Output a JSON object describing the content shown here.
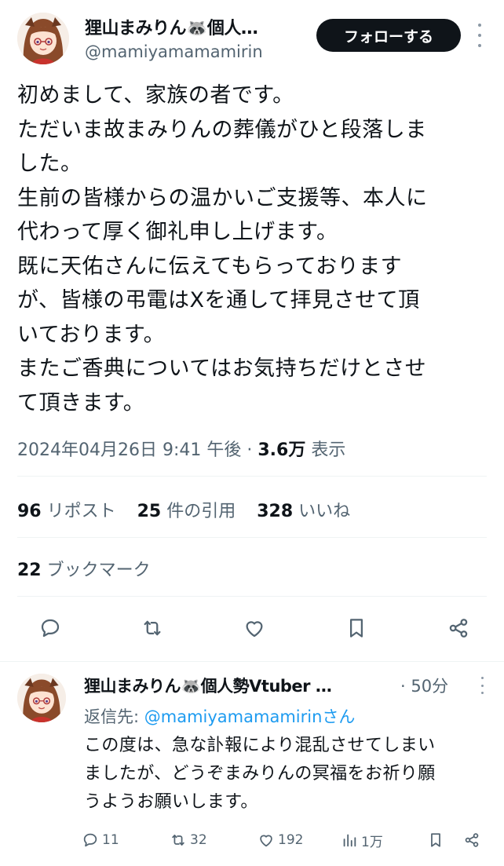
{
  "tweet": {
    "author": {
      "display_name": "狸山まみりん🦝個人…",
      "handle": "@mamiyamamamirin"
    },
    "follow_label": "フォローする",
    "lines": [
      "初めまして、家族の者です。",
      "ただいま故まみりんの葬儀がひと段落しま",
      "した。",
      "生前の皆様からの温かいご支援等、本人に",
      "代わって厚く御礼申し上げます。",
      "既に天佑さんに伝えてもらっております",
      "が、皆様の弔電はXを通して拝見させて頂",
      "いております。",
      "またご香典についてはお気持ちだけとさせ",
      "て頂きます。"
    ],
    "timestamp": "2024年04月26日 9:41 午後",
    "separator": " · ",
    "views_count": "3.6万",
    "views_label": " 表示",
    "stats": {
      "reposts_count": "96",
      "reposts_label": " リポスト",
      "quotes_count": "25",
      "quotes_label": " 件の引用",
      "likes_count": "328",
      "likes_label": " いいね",
      "bookmarks_count": "22",
      "bookmarks_label": " ブックマーク"
    }
  },
  "reply": {
    "display_name": "狸山まみりん🦝個人勢Vtuber …",
    "time": "· 50分",
    "replying_prefix": "返信先: ",
    "replying_to": "@mamiyamamamirinさん",
    "lines": [
      "この度は、急な訃報により混乱させてしまい",
      "ましたが、どうぞまみりんの冥福をお祈り願",
      "うようお願いします。"
    ],
    "counts": {
      "replies": "11",
      "reposts": "32",
      "likes": "192",
      "views": "1万"
    }
  },
  "icons": {
    "main_actions": [
      "reply-icon",
      "repost-icon",
      "like-icon",
      "bookmark-icon",
      "share-icon"
    ],
    "reply_actions": [
      "reply-icon",
      "repost-icon",
      "like-icon",
      "views-icon",
      "bookmark-icon",
      "share-icon"
    ]
  },
  "colors": {
    "text": "#0f1419",
    "secondary": "#536471",
    "link": "#1d9bf0",
    "follow_bg": "#0f1419",
    "divider": "#eff3f4"
  }
}
